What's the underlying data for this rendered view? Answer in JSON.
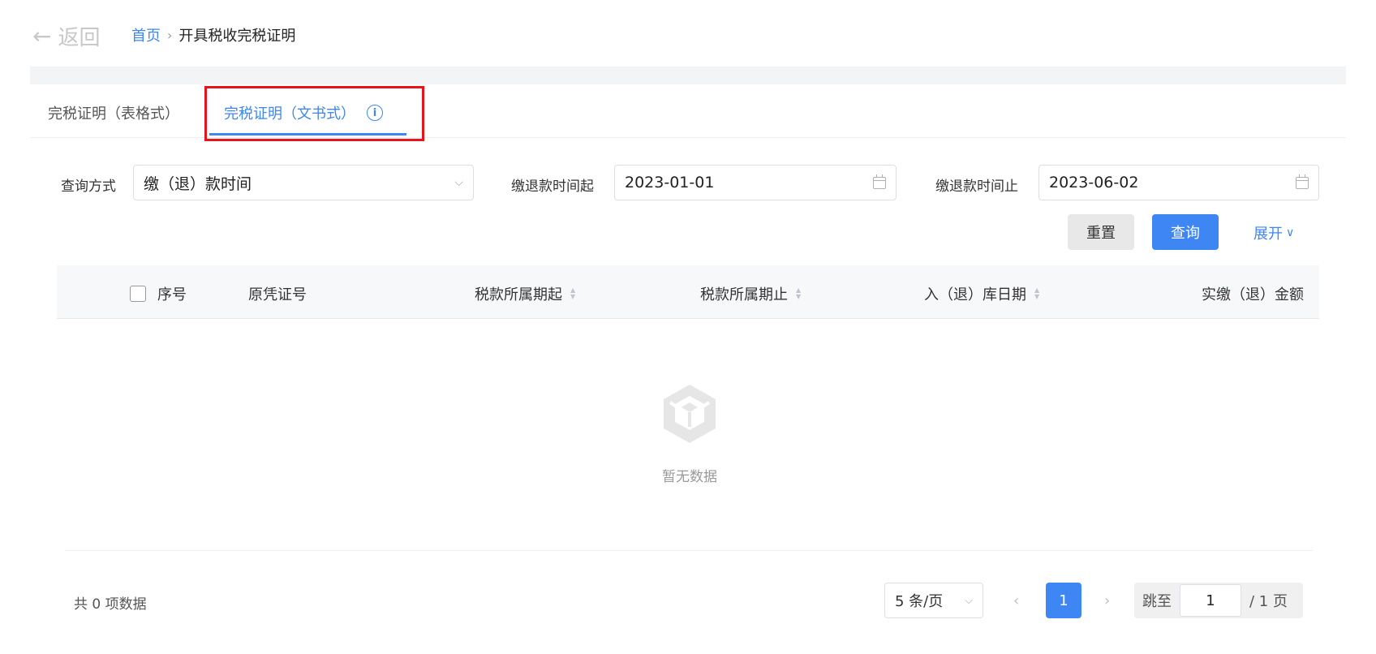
{
  "header": {
    "back_label": "返回",
    "breadcrumb": {
      "home": "首页",
      "current": "开具税收完税证明"
    }
  },
  "tabs": [
    {
      "label": "完税证明（表格式）",
      "active": false
    },
    {
      "label": "完税证明（文书式）",
      "active": true
    }
  ],
  "filters": {
    "query_method": {
      "label": "查询方式",
      "value": "缴（退）款时间"
    },
    "start_date": {
      "label": "缴退款时间起",
      "value": "2023-01-01"
    },
    "end_date": {
      "label": "缴退款时间止",
      "value": "2023-06-02"
    }
  },
  "actions": {
    "reset": "重置",
    "query": "查询",
    "expand": "展开"
  },
  "table": {
    "columns": [
      "序号",
      "原凭证号",
      "税款所属期起",
      "税款所属期止",
      "入（退）库日期",
      "实缴（退）金额"
    ],
    "rows": [],
    "empty_text": "暂无数据"
  },
  "pagination": {
    "total_text": "共 0 项数据",
    "page_size": "5 条/页",
    "current_page": "1",
    "jump_label": "跳至",
    "jump_value": "1",
    "total_pages_text": "/ 1 页"
  },
  "colors": {
    "primary": "#3f86f5",
    "highlight": "#e8141b"
  }
}
